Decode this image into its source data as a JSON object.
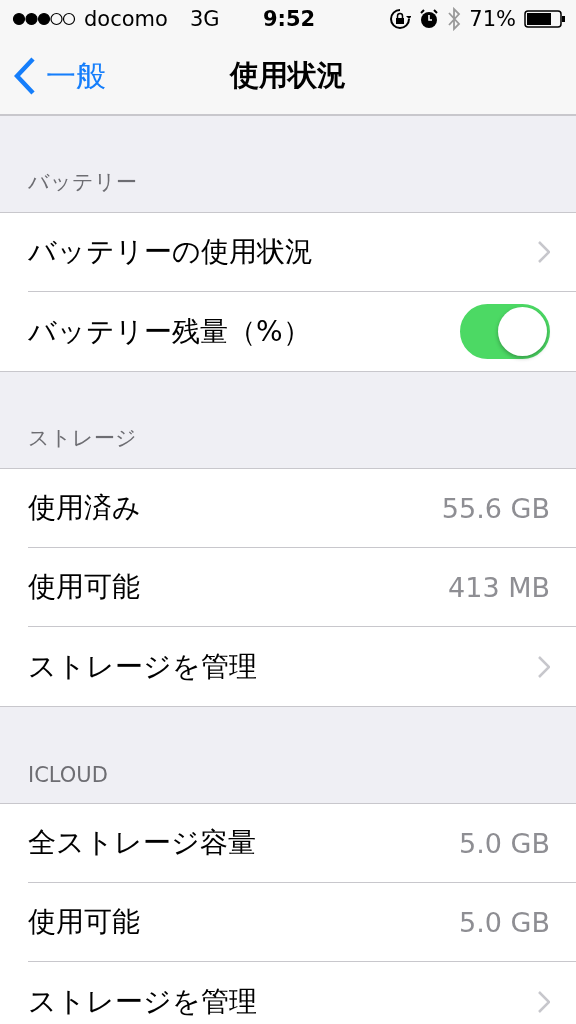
{
  "status_bar": {
    "carrier": "docomo",
    "network": "3G",
    "time": "9:52",
    "battery": "71%"
  },
  "nav": {
    "back": "一般",
    "title": "使用状況"
  },
  "sections": [
    {
      "header": "バッテリー",
      "rows": [
        {
          "kind": "chevron",
          "label": "バッテリーの使用状況"
        },
        {
          "kind": "toggle",
          "label": "バッテリー残量（%）",
          "on": true
        }
      ]
    },
    {
      "header": "ストレージ",
      "rows": [
        {
          "kind": "value",
          "label": "使用済み",
          "value": "55.6 GB"
        },
        {
          "kind": "value",
          "label": "使用可能",
          "value": "413 MB"
        },
        {
          "kind": "chevron",
          "label": "ストレージを管理"
        }
      ]
    },
    {
      "header": "ICLOUD",
      "rows": [
        {
          "kind": "value",
          "label": "全ストレージ容量",
          "value": "5.0 GB"
        },
        {
          "kind": "value",
          "label": "使用可能",
          "value": "5.0 GB"
        },
        {
          "kind": "chevron",
          "label": "ストレージを管理"
        }
      ]
    }
  ]
}
